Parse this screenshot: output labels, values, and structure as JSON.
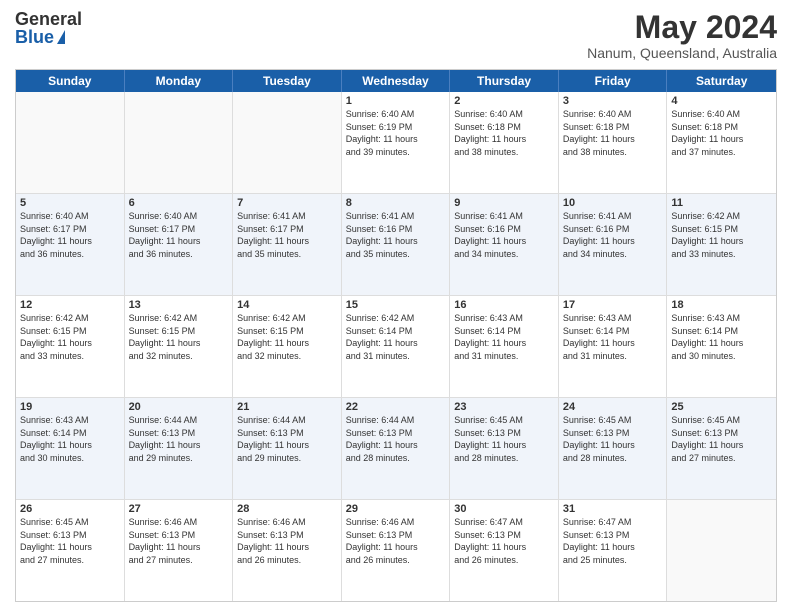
{
  "logo": {
    "general": "General",
    "blue": "Blue"
  },
  "title": "May 2024",
  "subtitle": "Nanum, Queensland, Australia",
  "days": [
    "Sunday",
    "Monday",
    "Tuesday",
    "Wednesday",
    "Thursday",
    "Friday",
    "Saturday"
  ],
  "weeks": [
    [
      {
        "day": "",
        "info": ""
      },
      {
        "day": "",
        "info": ""
      },
      {
        "day": "",
        "info": ""
      },
      {
        "day": "1",
        "info": "Sunrise: 6:40 AM\nSunset: 6:19 PM\nDaylight: 11 hours\nand 39 minutes."
      },
      {
        "day": "2",
        "info": "Sunrise: 6:40 AM\nSunset: 6:18 PM\nDaylight: 11 hours\nand 38 minutes."
      },
      {
        "day": "3",
        "info": "Sunrise: 6:40 AM\nSunset: 6:18 PM\nDaylight: 11 hours\nand 38 minutes."
      },
      {
        "day": "4",
        "info": "Sunrise: 6:40 AM\nSunset: 6:18 PM\nDaylight: 11 hours\nand 37 minutes."
      }
    ],
    [
      {
        "day": "5",
        "info": "Sunrise: 6:40 AM\nSunset: 6:17 PM\nDaylight: 11 hours\nand 36 minutes."
      },
      {
        "day": "6",
        "info": "Sunrise: 6:40 AM\nSunset: 6:17 PM\nDaylight: 11 hours\nand 36 minutes."
      },
      {
        "day": "7",
        "info": "Sunrise: 6:41 AM\nSunset: 6:17 PM\nDaylight: 11 hours\nand 35 minutes."
      },
      {
        "day": "8",
        "info": "Sunrise: 6:41 AM\nSunset: 6:16 PM\nDaylight: 11 hours\nand 35 minutes."
      },
      {
        "day": "9",
        "info": "Sunrise: 6:41 AM\nSunset: 6:16 PM\nDaylight: 11 hours\nand 34 minutes."
      },
      {
        "day": "10",
        "info": "Sunrise: 6:41 AM\nSunset: 6:16 PM\nDaylight: 11 hours\nand 34 minutes."
      },
      {
        "day": "11",
        "info": "Sunrise: 6:42 AM\nSunset: 6:15 PM\nDaylight: 11 hours\nand 33 minutes."
      }
    ],
    [
      {
        "day": "12",
        "info": "Sunrise: 6:42 AM\nSunset: 6:15 PM\nDaylight: 11 hours\nand 33 minutes."
      },
      {
        "day": "13",
        "info": "Sunrise: 6:42 AM\nSunset: 6:15 PM\nDaylight: 11 hours\nand 32 minutes."
      },
      {
        "day": "14",
        "info": "Sunrise: 6:42 AM\nSunset: 6:15 PM\nDaylight: 11 hours\nand 32 minutes."
      },
      {
        "day": "15",
        "info": "Sunrise: 6:42 AM\nSunset: 6:14 PM\nDaylight: 11 hours\nand 31 minutes."
      },
      {
        "day": "16",
        "info": "Sunrise: 6:43 AM\nSunset: 6:14 PM\nDaylight: 11 hours\nand 31 minutes."
      },
      {
        "day": "17",
        "info": "Sunrise: 6:43 AM\nSunset: 6:14 PM\nDaylight: 11 hours\nand 31 minutes."
      },
      {
        "day": "18",
        "info": "Sunrise: 6:43 AM\nSunset: 6:14 PM\nDaylight: 11 hours\nand 30 minutes."
      }
    ],
    [
      {
        "day": "19",
        "info": "Sunrise: 6:43 AM\nSunset: 6:14 PM\nDaylight: 11 hours\nand 30 minutes."
      },
      {
        "day": "20",
        "info": "Sunrise: 6:44 AM\nSunset: 6:13 PM\nDaylight: 11 hours\nand 29 minutes."
      },
      {
        "day": "21",
        "info": "Sunrise: 6:44 AM\nSunset: 6:13 PM\nDaylight: 11 hours\nand 29 minutes."
      },
      {
        "day": "22",
        "info": "Sunrise: 6:44 AM\nSunset: 6:13 PM\nDaylight: 11 hours\nand 28 minutes."
      },
      {
        "day": "23",
        "info": "Sunrise: 6:45 AM\nSunset: 6:13 PM\nDaylight: 11 hours\nand 28 minutes."
      },
      {
        "day": "24",
        "info": "Sunrise: 6:45 AM\nSunset: 6:13 PM\nDaylight: 11 hours\nand 28 minutes."
      },
      {
        "day": "25",
        "info": "Sunrise: 6:45 AM\nSunset: 6:13 PM\nDaylight: 11 hours\nand 27 minutes."
      }
    ],
    [
      {
        "day": "26",
        "info": "Sunrise: 6:45 AM\nSunset: 6:13 PM\nDaylight: 11 hours\nand 27 minutes."
      },
      {
        "day": "27",
        "info": "Sunrise: 6:46 AM\nSunset: 6:13 PM\nDaylight: 11 hours\nand 27 minutes."
      },
      {
        "day": "28",
        "info": "Sunrise: 6:46 AM\nSunset: 6:13 PM\nDaylight: 11 hours\nand 26 minutes."
      },
      {
        "day": "29",
        "info": "Sunrise: 6:46 AM\nSunset: 6:13 PM\nDaylight: 11 hours\nand 26 minutes."
      },
      {
        "day": "30",
        "info": "Sunrise: 6:47 AM\nSunset: 6:13 PM\nDaylight: 11 hours\nand 26 minutes."
      },
      {
        "day": "31",
        "info": "Sunrise: 6:47 AM\nSunset: 6:13 PM\nDaylight: 11 hours\nand 25 minutes."
      },
      {
        "day": "",
        "info": ""
      }
    ]
  ]
}
